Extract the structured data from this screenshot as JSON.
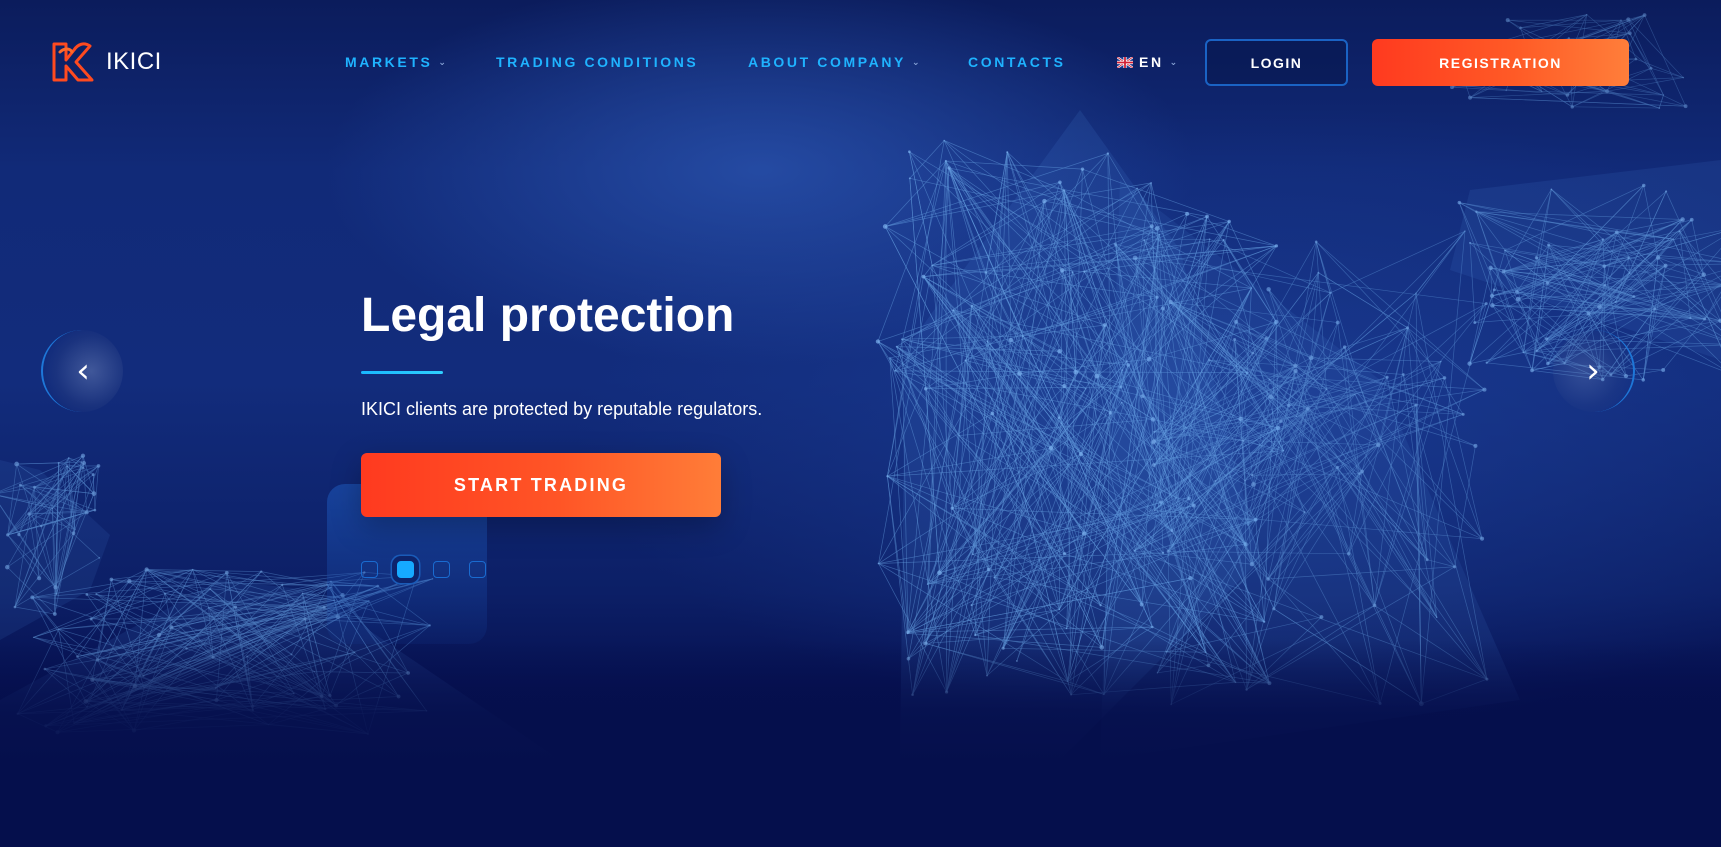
{
  "brand": {
    "name": "IKICI",
    "logo_icon": "k-logo-icon",
    "logo_color": "#ff4a1f"
  },
  "nav": {
    "items": [
      {
        "label": "MARKETS",
        "has_dropdown": true
      },
      {
        "label": "TRADING CONDITIONS",
        "has_dropdown": false
      },
      {
        "label": "ABOUT COMPANY",
        "has_dropdown": true
      },
      {
        "label": "CONTACTS",
        "has_dropdown": false
      }
    ],
    "chevron_glyph": "⌄",
    "language": {
      "label": "EN",
      "flag_icon": "uk-flag-icon",
      "has_dropdown": true
    }
  },
  "header": {
    "login_label": "LOGIN",
    "registration_label": "REGISTRATION"
  },
  "slider": {
    "title": "Legal protection",
    "text": "IKICI clients are protected by reputable regulators.",
    "cta_label": "START TRADING",
    "dot_count": 4,
    "active_index": 1,
    "prev_icon": "chevron-left-icon",
    "next_icon": "chevron-right-icon",
    "prev_glyph": "‹",
    "next_glyph": "›"
  },
  "colors": {
    "accent_orange": "#ff3a1f",
    "accent_orange_light": "#ff7e3a",
    "nav_blue": "#1fb3ff",
    "background_navy": "#06114a",
    "active_dot": "#16aaff"
  }
}
